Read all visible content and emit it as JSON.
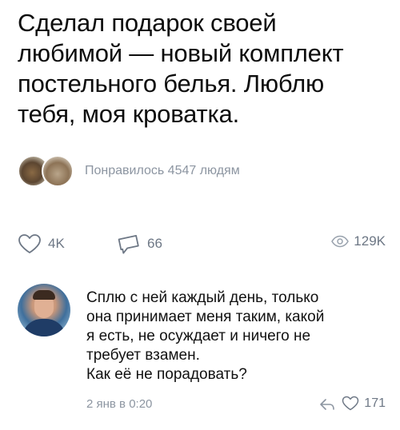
{
  "post": {
    "text": "Сделал подарок своей\nлюбимой — новый комплект\nпостельного белья. Люблю\nтебя, моя кроватка."
  },
  "likers": {
    "text": "Понравилось 4547 людям"
  },
  "actions": {
    "likes": "4K",
    "comments": "66",
    "views": "129K"
  },
  "comment": {
    "text": "Сплю с ней каждый день, только\nона принимает меня таким, какой\nя есть, не осуждает и ничего не\nтребует взамен.\nКак её не порадовать?",
    "date": "2 янв в 0:20",
    "likes": "171"
  },
  "colors": {
    "muted_text": "#8c95a1",
    "icon": "#6d7785"
  }
}
